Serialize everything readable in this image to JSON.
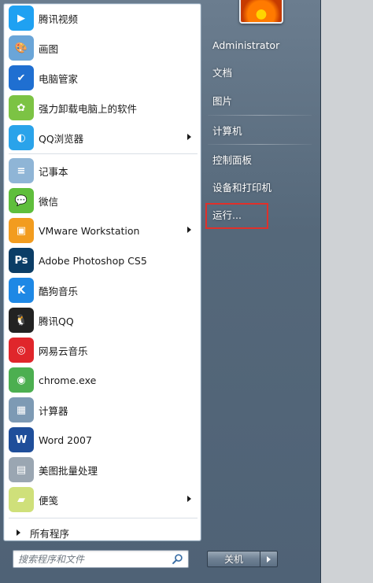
{
  "programs": [
    {
      "label": "腾讯视频",
      "icon": "tencent-video-icon",
      "color": "#1fa1f2",
      "glyph": "▶",
      "submenu": false
    },
    {
      "label": "画图",
      "icon": "paint-icon",
      "color": "#6aa5d8",
      "glyph": "🎨",
      "submenu": false
    },
    {
      "label": "电脑管家",
      "icon": "pc-manager-icon",
      "color": "#1f6fd1",
      "glyph": "✔",
      "submenu": false
    },
    {
      "label": "强力卸载电脑上的软件",
      "icon": "uninstaller-icon",
      "color": "#7cc344",
      "glyph": "✿",
      "submenu": false
    },
    {
      "label": "QQ浏览器",
      "icon": "qq-browser-icon",
      "color": "#2aa3ea",
      "glyph": "◐",
      "submenu": true
    },
    {
      "label": "记事本",
      "icon": "notepad-icon",
      "color": "#8fb5d6",
      "glyph": "≡",
      "submenu": false
    },
    {
      "label": "微信",
      "icon": "wechat-icon",
      "color": "#5fbe3c",
      "glyph": "💬",
      "submenu": false
    },
    {
      "label": "VMware Workstation",
      "icon": "vmware-icon",
      "color": "#f29c1f",
      "glyph": "▣",
      "submenu": true
    },
    {
      "label": "Adobe Photoshop CS5",
      "icon": "photoshop-icon",
      "color": "#0b3d66",
      "glyph": "Ps",
      "submenu": false
    },
    {
      "label": "酷狗音乐",
      "icon": "kugou-icon",
      "color": "#1e88e5",
      "glyph": "K",
      "submenu": false
    },
    {
      "label": "腾讯QQ",
      "icon": "qq-penguin-icon",
      "color": "#222222",
      "glyph": "🐧",
      "submenu": false
    },
    {
      "label": "网易云音乐",
      "icon": "netease-music-icon",
      "color": "#e0262b",
      "glyph": "◎",
      "submenu": false
    },
    {
      "label": "chrome.exe",
      "icon": "chrome-icon",
      "color": "#4caf50",
      "glyph": "◉",
      "submenu": false
    },
    {
      "label": "计算器",
      "icon": "calculator-icon",
      "color": "#7d9ab4",
      "glyph": "▦",
      "submenu": false
    },
    {
      "label": "Word 2007",
      "icon": "word-icon",
      "color": "#1f4e9a",
      "glyph": "W",
      "submenu": false
    },
    {
      "label": "美图批量处理",
      "icon": "meitu-batch-icon",
      "color": "#9aa6b2",
      "glyph": "▤",
      "submenu": false
    },
    {
      "label": "便笺",
      "icon": "sticky-notes-icon",
      "color": "#cfe07a",
      "glyph": "▰",
      "submenu": true
    }
  ],
  "all_programs_label": "所有程序",
  "search": {
    "placeholder": "搜索程序和文件"
  },
  "right_items": [
    {
      "label": "Administrator",
      "name": "right-item-administrator"
    },
    {
      "label": "文档",
      "name": "right-item-documents"
    },
    {
      "label": "图片",
      "name": "right-item-pictures"
    },
    {
      "label": "计算机",
      "name": "right-item-computer"
    },
    {
      "label": "控制面板",
      "name": "right-item-control-panel"
    },
    {
      "label": "设备和打印机",
      "name": "right-item-devices-printers"
    },
    {
      "label": "运行...",
      "name": "right-item-run"
    }
  ],
  "shutdown": {
    "label": "关机"
  },
  "colors": {
    "highlight": "#e0302a",
    "panel": "#55687a"
  }
}
